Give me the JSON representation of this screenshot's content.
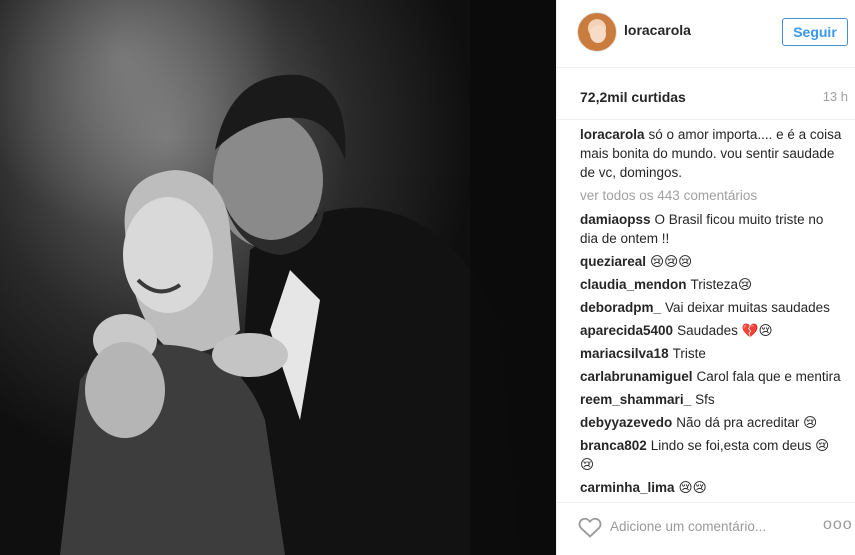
{
  "post": {
    "author": "loracarola",
    "follow_label": "Seguir",
    "likes": "72,2mil curtidas",
    "time": "13 h",
    "caption": "só o amor importa.... e é a coisa mais bonita do mundo. vou sentir saudade de vc, domingos.",
    "view_all": "ver todos os 443 comentários"
  },
  "comments": [
    {
      "user": "damiaopss",
      "text": "O Brasil ficou muito triste no dia de ontem !!"
    },
    {
      "user": "queziareal",
      "text": "😢😢😢"
    },
    {
      "user": "claudia_mendon",
      "text": "Tristeza😢"
    },
    {
      "user": "deboradpm_",
      "text": "Vai deixar muitas saudades"
    },
    {
      "user": "aparecida5400",
      "text": "Saudades 💔😢"
    },
    {
      "user": "mariacsilva18",
      "text": "Triste"
    },
    {
      "user": "carlabrunamiguel",
      "text": "Carol fala que e mentira"
    },
    {
      "user": "reem_shammari_",
      "text": "Sfs"
    },
    {
      "user": "debyyazevedo",
      "text": "Não dá pra acreditar 😢"
    },
    {
      "user": "branca802",
      "text": "Lindo se foi,esta com deus 😢😢"
    },
    {
      "user": "carminha_lima",
      "text": "😢😢"
    }
  ],
  "footer": {
    "comment_placeholder": "Adicione um comentário...",
    "more_label": "ooo",
    "like_icon": "heart-outline"
  }
}
